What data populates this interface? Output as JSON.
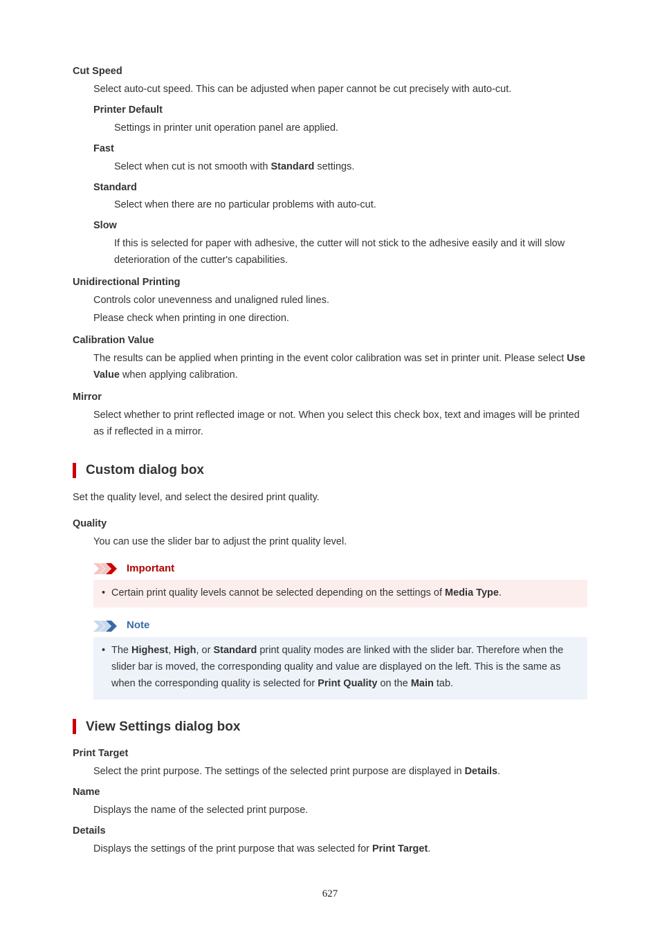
{
  "cutspeed": {
    "term": "Cut Speed",
    "desc": "Select auto-cut speed. This can be adjusted when paper cannot be cut precisely with auto-cut.",
    "printer_default": {
      "term": "Printer Default",
      "desc": "Settings in printer unit operation panel are applied."
    },
    "fast": {
      "term": "Fast",
      "desc_before": "Select when cut is not smooth with ",
      "bold": "Standard",
      "desc_after": " settings."
    },
    "standard": {
      "term": "Standard",
      "desc": "Select when there are no particular problems with auto-cut."
    },
    "slow": {
      "term": "Slow",
      "desc": "If this is selected for paper with adhesive, the cutter will not stick to the adhesive easily and it will slow deterioration of the cutter's capabilities."
    }
  },
  "uni": {
    "term": "Unidirectional Printing",
    "line1": "Controls color unevenness and unaligned ruled lines.",
    "line2": "Please check when printing in one direction."
  },
  "calib": {
    "term": "Calibration Value",
    "desc_before": "The results can be applied when printing in the event color calibration was set in printer unit. Please select ",
    "bold": "Use Value",
    "desc_after": " when applying calibration."
  },
  "mirror": {
    "term": "Mirror",
    "desc": "Select whether to print reflected image or not. When you select this check box, text and images will be printed as if reflected in a mirror."
  },
  "custom": {
    "heading": "Custom dialog box",
    "lead": "Set the quality level, and select the desired print quality.",
    "quality": {
      "term": "Quality",
      "desc": "You can use the slider bar to adjust the print quality level."
    },
    "important": {
      "title": "Important",
      "b1a": "Certain print quality levels cannot be selected depending on the settings of ",
      "b1bold": "Media Type",
      "b1b": "."
    },
    "note": {
      "title": "Note",
      "pre": "The ",
      "w1": "Highest",
      "c1": ", ",
      "w2": "High",
      "c2": ", or ",
      "w3": "Standard",
      "mid": " print quality modes are linked with the slider bar. Therefore when the slider bar is moved, the corresponding quality and value are displayed on the left. This is the same as when the corresponding quality is selected for ",
      "w4": "Print Quality",
      "on": " on the ",
      "w5": "Main",
      "tail": " tab."
    }
  },
  "view": {
    "heading": "View Settings dialog box",
    "print_target": {
      "term": "Print Target",
      "desc_before": "Select the print purpose. The settings of the selected print purpose are displayed in ",
      "bold": "Details",
      "desc_after": "."
    },
    "name": {
      "term": "Name",
      "desc": "Displays the name of the selected print purpose."
    },
    "details": {
      "term": "Details",
      "desc_before": "Displays the settings of the print purpose that was selected for ",
      "bold": "Print Target",
      "desc_after": "."
    }
  },
  "page_number": "627"
}
